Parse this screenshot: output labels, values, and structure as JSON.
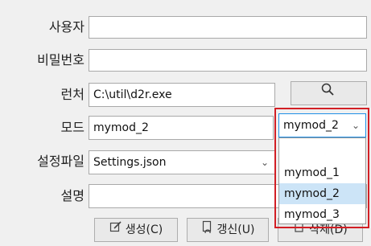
{
  "form": {
    "user_label": "사용자",
    "user_value": "",
    "password_label": "비밀번호",
    "password_value": "",
    "launcher_label": "런처",
    "launcher_value": "C:\\util\\d2r.exe",
    "browse_icon": "search-icon",
    "mode_label": "모드",
    "mode_value": "mymod_2",
    "mode_combo_value": "mymod_2",
    "settings_label": "설정파일",
    "settings_value": "Settings.json",
    "desc_label": "설명",
    "desc_value": ""
  },
  "mode_dropdown": {
    "options": [
      "mymod_1",
      "mymod_2",
      "mymod_3"
    ],
    "selected": "mymod_2",
    "highlight_color": "#cce4f7",
    "frame_color": "#d21f25"
  },
  "buttons": {
    "create_label": "생성(C)",
    "update_label": "갱신(U)",
    "delete_label": "삭제(D)",
    "create_icon": "edit-icon",
    "update_icon": "refresh-document-icon",
    "delete_icon": "delete-icon"
  }
}
